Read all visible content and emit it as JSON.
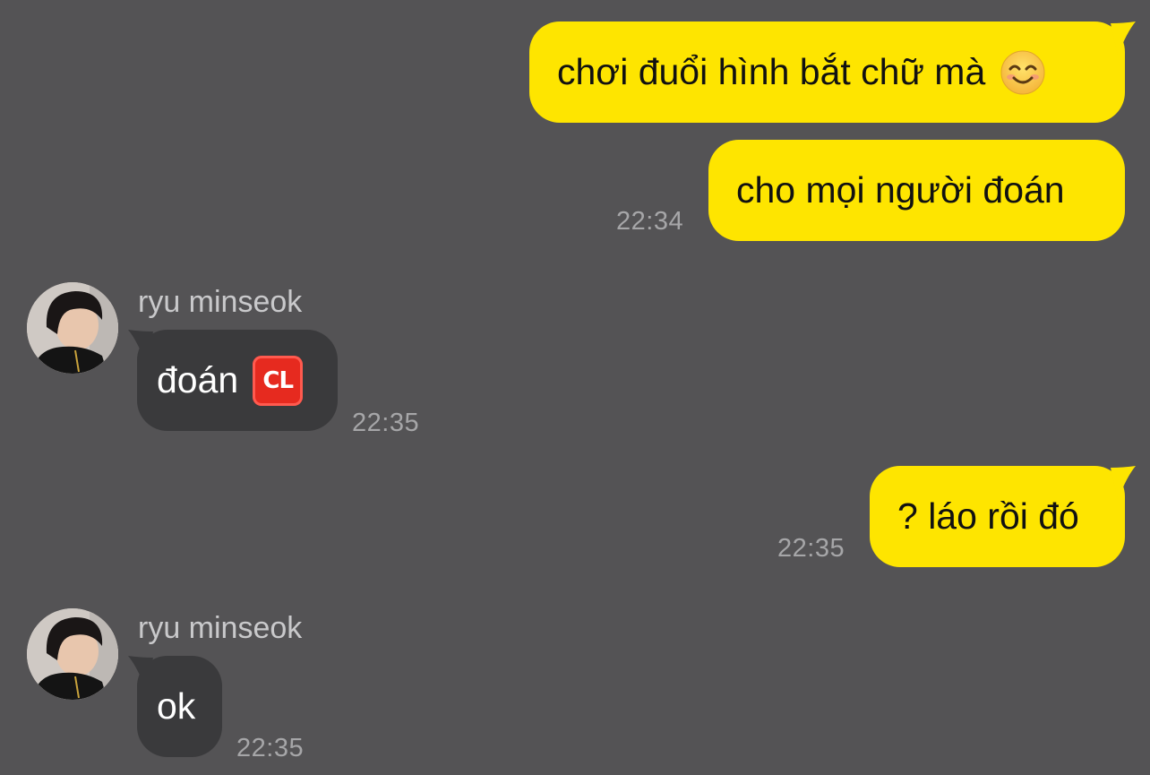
{
  "conversation": {
    "messages": [
      {
        "direction": "outgoing",
        "text": "chơi đuổi hình bắt chữ mà",
        "emoji": "smiling-face-icon"
      },
      {
        "direction": "outgoing",
        "text": "cho mọi người đoán",
        "time": "22:34"
      },
      {
        "direction": "incoming",
        "sender": "ryu minseok",
        "text": "đoán",
        "emoji": "cl-button-icon",
        "emoji_text": "CL",
        "time": "22:35"
      },
      {
        "direction": "outgoing",
        "text": "? láo rồi đó",
        "time": "22:35"
      },
      {
        "direction": "incoming",
        "sender": "ryu minseok",
        "text": "ok",
        "time": "22:35"
      }
    ]
  },
  "colors": {
    "background": "#545355",
    "outgoing_bubble": "#fee500",
    "incoming_bubble": "#3a3a3c",
    "timestamp": "#a6a6a8"
  }
}
